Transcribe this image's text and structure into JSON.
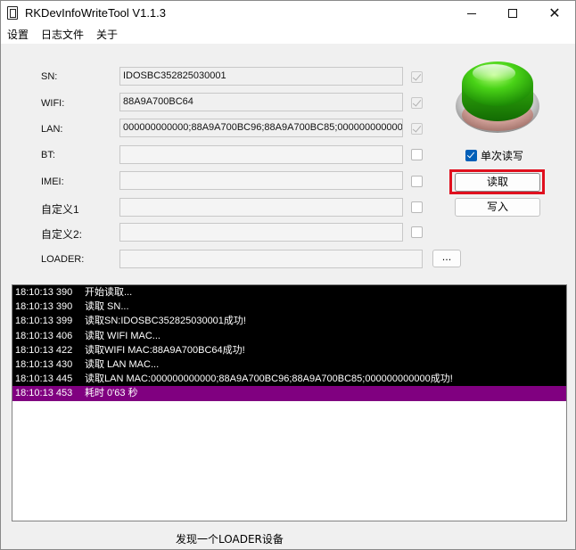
{
  "window": {
    "title": "RKDevInfoWriteTool V1.1.3",
    "icons": [
      "app-icon",
      "minimize-icon",
      "maximize-icon",
      "close-icon"
    ]
  },
  "menu": [
    "设置",
    "日志文件",
    "关于"
  ],
  "fields": {
    "sn": {
      "label": "SN:",
      "value": "IDOSBC352825030001",
      "checked": true
    },
    "wifi": {
      "label": "WIFI:",
      "value": "88A9A700BC64",
      "checked": true
    },
    "lan": {
      "label": "LAN:",
      "value": "000000000000;88A9A700BC96;88A9A700BC85;000000000000",
      "checked": true
    },
    "bt": {
      "label": "BT:",
      "value": "",
      "checked": false
    },
    "imei": {
      "label": "IMEI:",
      "value": "",
      "checked": false
    },
    "custom1": {
      "label": "自定义1",
      "value": "",
      "checked": false
    },
    "custom2": {
      "label": "自定义2:",
      "value": "",
      "checked": false
    },
    "loader": {
      "label": "LOADER:",
      "value": "",
      "browse_label": "..."
    }
  },
  "controls": {
    "single_rw_label": "单次读写",
    "single_rw_checked": true,
    "read_label": "读取",
    "write_label": "写入",
    "status_led_color": "#3dd11a",
    "highlight_color": "#e0101e"
  },
  "log": [
    {
      "time": "18:10:13 390",
      "msg": "开始读取..."
    },
    {
      "time": "18:10:13 390",
      "msg": "读取 SN..."
    },
    {
      "time": "18:10:13 399",
      "msg": "读取SN:IDOSBC352825030001成功!"
    },
    {
      "time": "18:10:13 406",
      "msg": "读取 WIFI MAC..."
    },
    {
      "time": "18:10:13 422",
      "msg": "读取WIFI MAC:88A9A700BC64成功!"
    },
    {
      "time": "18:10:13 430",
      "msg": "读取 LAN MAC..."
    },
    {
      "time": "18:10:13 445",
      "msg": "读取LAN MAC:000000000000;88A9A700BC96;88A9A700BC85;000000000000成功!"
    },
    {
      "time": "18:10:13 453",
      "msg": "耗时 0'63 秒",
      "highlight": true
    }
  ],
  "status": "发现一个LOADER设备"
}
